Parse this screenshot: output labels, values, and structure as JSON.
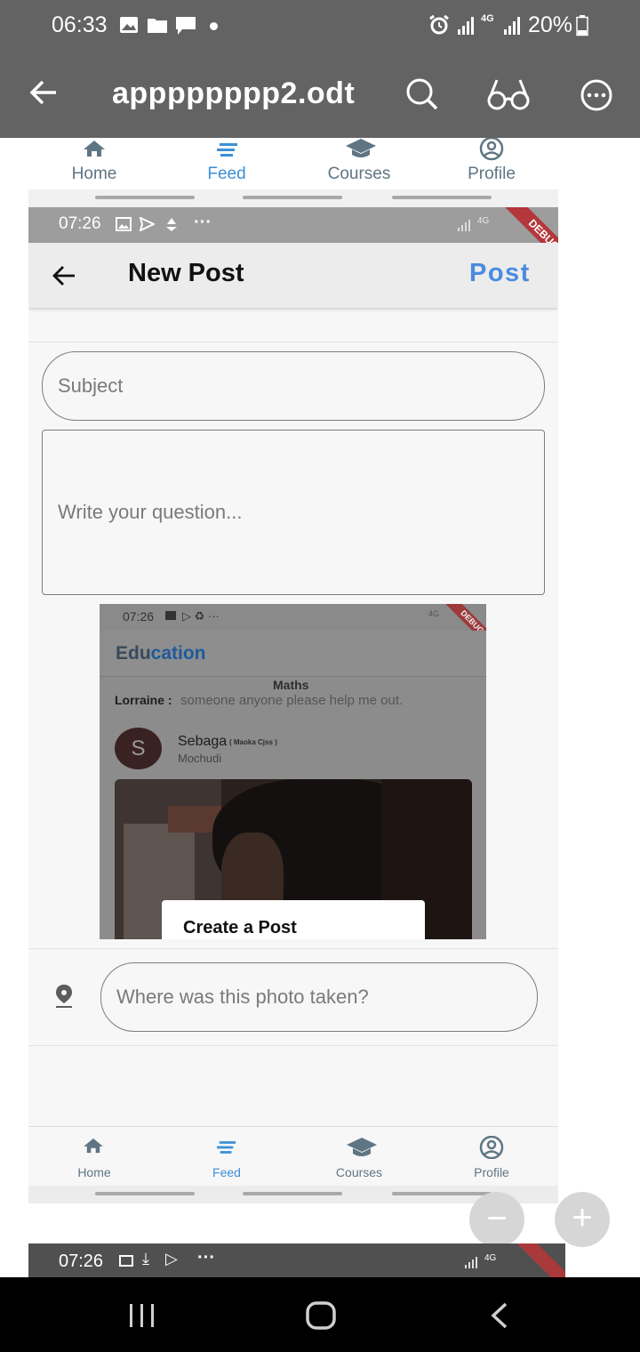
{
  "os_status": {
    "time": "06:33",
    "battery": "20%",
    "network": "4G"
  },
  "app_bar": {
    "title": "apppppppp2.odt",
    "back_icon": "arrow-left-icon",
    "search_icon": "search-icon",
    "reader_icon": "glasses-icon",
    "more_icon": "more-horizontal-icon"
  },
  "top_nav": {
    "items": [
      {
        "label": "Home",
        "icon": "home-icon"
      },
      {
        "label": "Feed",
        "icon": "feed-icon"
      },
      {
        "label": "Courses",
        "icon": "graduation-cap-icon"
      },
      {
        "label": "Profile",
        "icon": "profile-icon"
      }
    ]
  },
  "inner_status": {
    "time": "07:26",
    "network": "4G",
    "debug": "DEBUG"
  },
  "new_post": {
    "title": "New Post",
    "post_button": "Post",
    "subject_placeholder": "Subject",
    "question_placeholder": "Write your question...",
    "location_placeholder": "Where was this photo taken?"
  },
  "screenshot": {
    "time": "07:26",
    "network": "4G",
    "debug": "DEBUG",
    "app_title_dark": "Edu",
    "app_title_blue": "cation",
    "topic": "Maths",
    "author": "Lorraine :",
    "message": "someone anyone   please help me out.",
    "avatar_letter": "S",
    "user_name": "Sebaga",
    "user_school": "( Maoka Cjss )",
    "user_village": "Mochudi",
    "dialog_title": "Create a Post"
  },
  "bottom_nav_inner": {
    "items": [
      {
        "label": "Home"
      },
      {
        "label": "Feed"
      },
      {
        "label": "Courses"
      },
      {
        "label": "Profile"
      }
    ]
  },
  "next_page_status": {
    "time": "07:26",
    "network": "4G"
  },
  "zoom": {
    "out": "−",
    "in": "+"
  },
  "colors": {
    "chrome": "#636363",
    "accent": "#3d8fd6",
    "nav_text": "#5f7584",
    "post_button": "#4a8be0"
  }
}
